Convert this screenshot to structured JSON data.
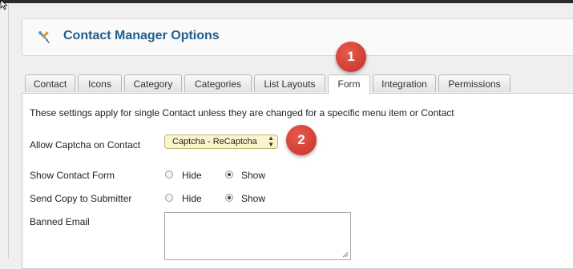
{
  "header": {
    "title": "Contact Manager Options",
    "icon": "tools-icon"
  },
  "tabs": [
    {
      "label": "Contact",
      "active": false
    },
    {
      "label": "Icons",
      "active": false
    },
    {
      "label": "Category",
      "active": false
    },
    {
      "label": "Categories",
      "active": false
    },
    {
      "label": "List Layouts",
      "active": false
    },
    {
      "label": "Form",
      "active": true
    },
    {
      "label": "Integration",
      "active": false
    },
    {
      "label": "Permissions",
      "active": false
    }
  ],
  "panel": {
    "description": "These settings apply for single Contact unless they are changed for a specific menu item or Contact",
    "captcha": {
      "label": "Allow Captcha on Contact",
      "selected": "Captcha - ReCaptcha"
    },
    "show_contact_form": {
      "label": "Show Contact Form",
      "options": [
        "Hide",
        "Show"
      ],
      "selected": "Show"
    },
    "send_copy": {
      "label": "Send Copy to Submitter",
      "options": [
        "Hide",
        "Show"
      ],
      "selected": "Show"
    },
    "banned_email": {
      "label": "Banned Email",
      "value": ""
    }
  },
  "annotations": [
    "1",
    "2"
  ],
  "colors": {
    "title": "#1f5e8c",
    "badge": "#d43f35",
    "select_bg": "#fbf5cf"
  }
}
